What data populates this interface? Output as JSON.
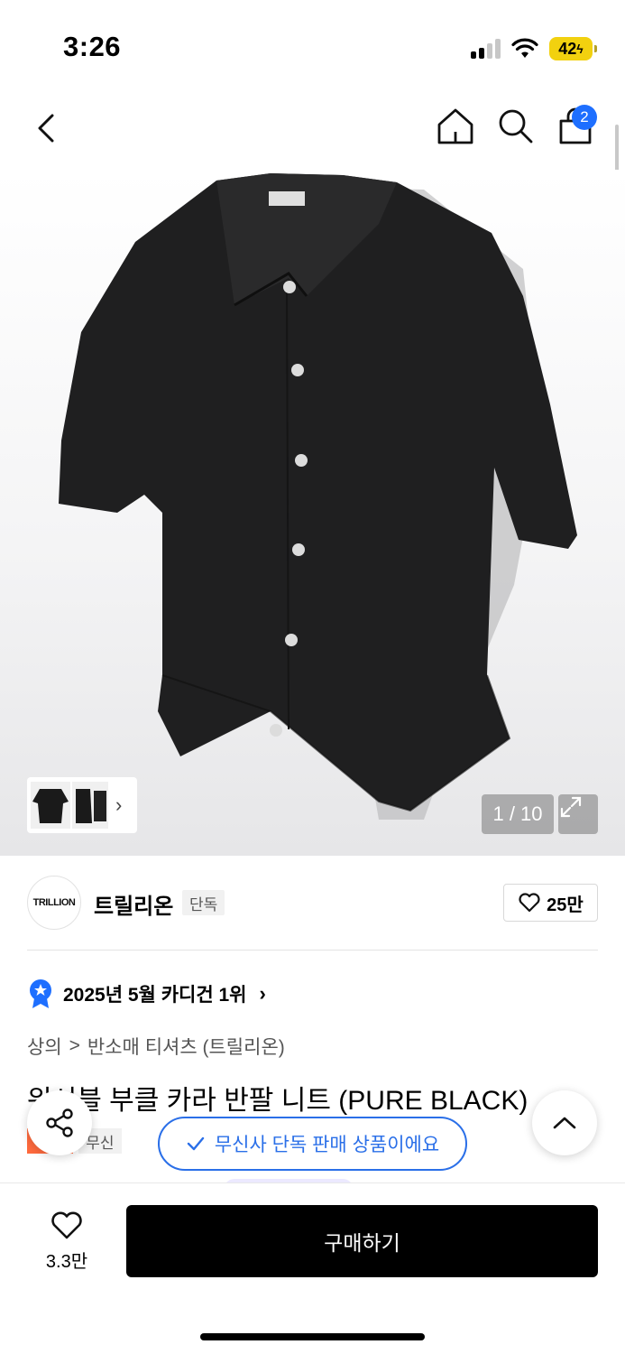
{
  "status_bar": {
    "time": "3:26",
    "battery": "42"
  },
  "nav": {
    "cart_count": "2",
    "icons": [
      "back-icon",
      "home-icon",
      "search-icon",
      "cart-icon"
    ]
  },
  "hero": {
    "page_counter": "1 / 10"
  },
  "brand": {
    "logo_text": "TRILLION",
    "name": "트릴리온",
    "badge": "단독",
    "likes": "25만"
  },
  "ranking": {
    "label": "2025년 5월 카디건 1위"
  },
  "breadcrumb": {
    "level1": "상의",
    "separator": ">",
    "level2": "반소매 티셔츠 (트릴리온)"
  },
  "product": {
    "title": "워셔블 부클 카라 반팔 니트 (PURE BLACK)",
    "sale_badge": "세일",
    "free_badge": "무신"
  },
  "toast": {
    "text": "무신사 단독 판매 상품이에요"
  },
  "bottom_bar": {
    "wish_count": "3.3만",
    "buy_label": "구매하기"
  },
  "colors": {
    "accent_blue": "#2a6fe8",
    "badge_blue": "#1e6fff",
    "sale_orange": "#ff6a3d",
    "battery_yellow": "#f2d10f"
  }
}
